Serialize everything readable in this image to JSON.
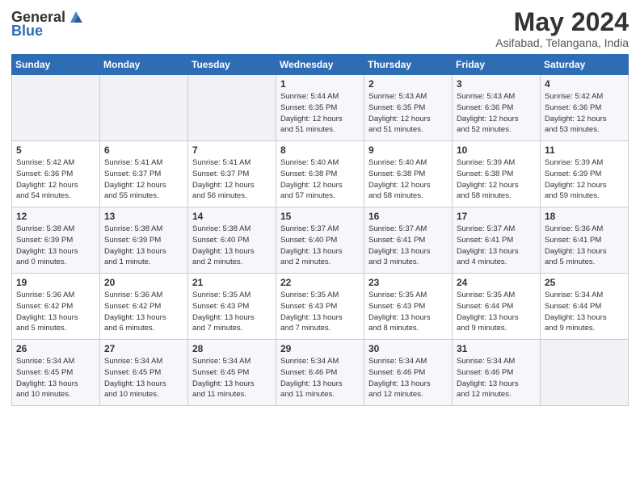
{
  "logo": {
    "general": "General",
    "blue": "Blue"
  },
  "title": "May 2024",
  "location": "Asifabad, Telangana, India",
  "headers": [
    "Sunday",
    "Monday",
    "Tuesday",
    "Wednesday",
    "Thursday",
    "Friday",
    "Saturday"
  ],
  "weeks": [
    [
      {
        "day": "",
        "info": ""
      },
      {
        "day": "",
        "info": ""
      },
      {
        "day": "",
        "info": ""
      },
      {
        "day": "1",
        "info": "Sunrise: 5:44 AM\nSunset: 6:35 PM\nDaylight: 12 hours\nand 51 minutes."
      },
      {
        "day": "2",
        "info": "Sunrise: 5:43 AM\nSunset: 6:35 PM\nDaylight: 12 hours\nand 51 minutes."
      },
      {
        "day": "3",
        "info": "Sunrise: 5:43 AM\nSunset: 6:36 PM\nDaylight: 12 hours\nand 52 minutes."
      },
      {
        "day": "4",
        "info": "Sunrise: 5:42 AM\nSunset: 6:36 PM\nDaylight: 12 hours\nand 53 minutes."
      }
    ],
    [
      {
        "day": "5",
        "info": "Sunrise: 5:42 AM\nSunset: 6:36 PM\nDaylight: 12 hours\nand 54 minutes."
      },
      {
        "day": "6",
        "info": "Sunrise: 5:41 AM\nSunset: 6:37 PM\nDaylight: 12 hours\nand 55 minutes."
      },
      {
        "day": "7",
        "info": "Sunrise: 5:41 AM\nSunset: 6:37 PM\nDaylight: 12 hours\nand 56 minutes."
      },
      {
        "day": "8",
        "info": "Sunrise: 5:40 AM\nSunset: 6:38 PM\nDaylight: 12 hours\nand 57 minutes."
      },
      {
        "day": "9",
        "info": "Sunrise: 5:40 AM\nSunset: 6:38 PM\nDaylight: 12 hours\nand 58 minutes."
      },
      {
        "day": "10",
        "info": "Sunrise: 5:39 AM\nSunset: 6:38 PM\nDaylight: 12 hours\nand 58 minutes."
      },
      {
        "day": "11",
        "info": "Sunrise: 5:39 AM\nSunset: 6:39 PM\nDaylight: 12 hours\nand 59 minutes."
      }
    ],
    [
      {
        "day": "12",
        "info": "Sunrise: 5:38 AM\nSunset: 6:39 PM\nDaylight: 13 hours\nand 0 minutes."
      },
      {
        "day": "13",
        "info": "Sunrise: 5:38 AM\nSunset: 6:39 PM\nDaylight: 13 hours\nand 1 minute."
      },
      {
        "day": "14",
        "info": "Sunrise: 5:38 AM\nSunset: 6:40 PM\nDaylight: 13 hours\nand 2 minutes."
      },
      {
        "day": "15",
        "info": "Sunrise: 5:37 AM\nSunset: 6:40 PM\nDaylight: 13 hours\nand 2 minutes."
      },
      {
        "day": "16",
        "info": "Sunrise: 5:37 AM\nSunset: 6:41 PM\nDaylight: 13 hours\nand 3 minutes."
      },
      {
        "day": "17",
        "info": "Sunrise: 5:37 AM\nSunset: 6:41 PM\nDaylight: 13 hours\nand 4 minutes."
      },
      {
        "day": "18",
        "info": "Sunrise: 5:36 AM\nSunset: 6:41 PM\nDaylight: 13 hours\nand 5 minutes."
      }
    ],
    [
      {
        "day": "19",
        "info": "Sunrise: 5:36 AM\nSunset: 6:42 PM\nDaylight: 13 hours\nand 5 minutes."
      },
      {
        "day": "20",
        "info": "Sunrise: 5:36 AM\nSunset: 6:42 PM\nDaylight: 13 hours\nand 6 minutes."
      },
      {
        "day": "21",
        "info": "Sunrise: 5:35 AM\nSunset: 6:43 PM\nDaylight: 13 hours\nand 7 minutes."
      },
      {
        "day": "22",
        "info": "Sunrise: 5:35 AM\nSunset: 6:43 PM\nDaylight: 13 hours\nand 7 minutes."
      },
      {
        "day": "23",
        "info": "Sunrise: 5:35 AM\nSunset: 6:43 PM\nDaylight: 13 hours\nand 8 minutes."
      },
      {
        "day": "24",
        "info": "Sunrise: 5:35 AM\nSunset: 6:44 PM\nDaylight: 13 hours\nand 9 minutes."
      },
      {
        "day": "25",
        "info": "Sunrise: 5:34 AM\nSunset: 6:44 PM\nDaylight: 13 hours\nand 9 minutes."
      }
    ],
    [
      {
        "day": "26",
        "info": "Sunrise: 5:34 AM\nSunset: 6:45 PM\nDaylight: 13 hours\nand 10 minutes."
      },
      {
        "day": "27",
        "info": "Sunrise: 5:34 AM\nSunset: 6:45 PM\nDaylight: 13 hours\nand 10 minutes."
      },
      {
        "day": "28",
        "info": "Sunrise: 5:34 AM\nSunset: 6:45 PM\nDaylight: 13 hours\nand 11 minutes."
      },
      {
        "day": "29",
        "info": "Sunrise: 5:34 AM\nSunset: 6:46 PM\nDaylight: 13 hours\nand 11 minutes."
      },
      {
        "day": "30",
        "info": "Sunrise: 5:34 AM\nSunset: 6:46 PM\nDaylight: 13 hours\nand 12 minutes."
      },
      {
        "day": "31",
        "info": "Sunrise: 5:34 AM\nSunset: 6:46 PM\nDaylight: 13 hours\nand 12 minutes."
      },
      {
        "day": "",
        "info": ""
      }
    ]
  ]
}
